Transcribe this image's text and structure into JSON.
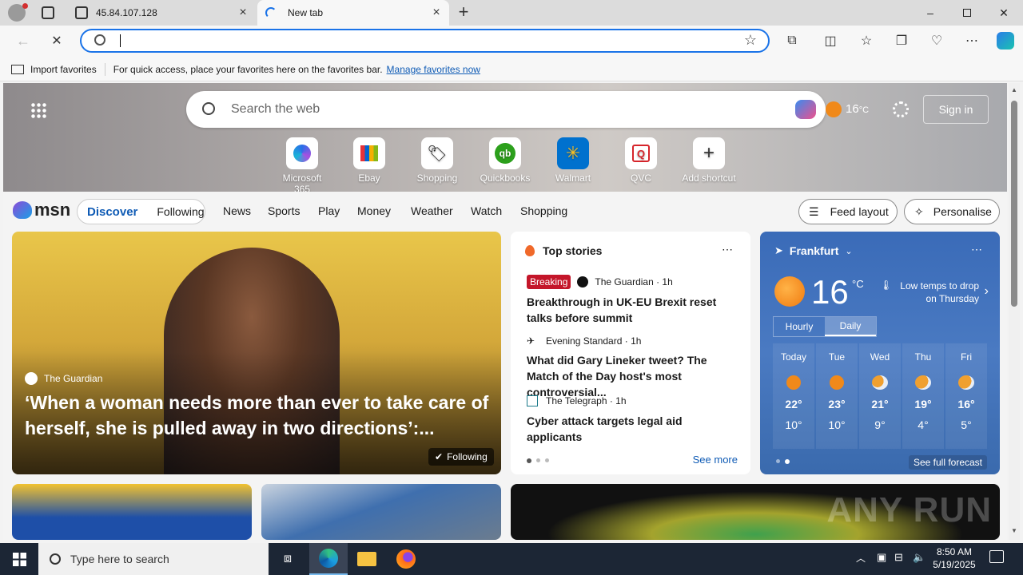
{
  "browser": {
    "tabs": [
      {
        "title": "45.84.107.128"
      },
      {
        "title": "New tab"
      }
    ],
    "address_placeholder": "",
    "favorites_bar": {
      "import_label": "Import favorites",
      "hint": "For quick access, place your favorites here on the favorites bar.",
      "manage_link": "Manage favorites now"
    }
  },
  "msn": {
    "search_placeholder": "Search the web",
    "temperature": "16",
    "temp_unit": "°C",
    "sign_in": "Sign in",
    "shortcuts": [
      {
        "label": "Microsoft 365"
      },
      {
        "label": "Ebay"
      },
      {
        "label": "Shopping"
      },
      {
        "label": "Quickbooks"
      },
      {
        "label": "Walmart"
      },
      {
        "label": "QVC"
      },
      {
        "label": "Add shortcut"
      }
    ],
    "logo": "msn",
    "nav": {
      "discover": "Discover",
      "following": "Following",
      "links": [
        "News",
        "Sports",
        "Play",
        "Money",
        "Weather",
        "Watch",
        "Shopping"
      ],
      "feed_layout": "Feed layout",
      "personalise": "Personalise"
    },
    "hero_story": {
      "source": "The Guardian",
      "headline": "‘When a woman needs more than ever to take care of herself, she is pulled away in two directions’:...",
      "follow_badge": "Following"
    },
    "top_stories": {
      "title": "Top stories",
      "items": [
        {
          "badge": "Breaking",
          "source": "The Guardian · 1h",
          "headline": "Breakthrough in UK-EU Brexit reset talks before summit"
        },
        {
          "badge": "",
          "source": "Evening Standard · 1h",
          "headline": "What did Gary Lineker tweet? The Match of the Day host's most controversial..."
        },
        {
          "badge": "",
          "source": "The Telegraph · 1h",
          "headline": "Cyber attack targets legal aid applicants"
        }
      ],
      "see_more": "See more"
    },
    "weather": {
      "city": "Frankfurt",
      "temp": "16",
      "unit": "°C",
      "note": "Low temps to drop on Thursday",
      "tab_hourly": "Hourly",
      "tab_daily": "Daily",
      "days": [
        {
          "day": "Today",
          "hi": "22°",
          "lo": "10°"
        },
        {
          "day": "Tue",
          "hi": "23°",
          "lo": "10°"
        },
        {
          "day": "Wed",
          "hi": "21°",
          "lo": "9°"
        },
        {
          "day": "Thu",
          "hi": "19°",
          "lo": "4°"
        },
        {
          "day": "Fri",
          "hi": "16°",
          "lo": "5°"
        }
      ],
      "see_full": "See full forecast"
    },
    "watermark": "ANY RUN"
  },
  "taskbar": {
    "search_placeholder": "Type here to search",
    "time": "8:50 AM",
    "date": "5/19/2025"
  }
}
